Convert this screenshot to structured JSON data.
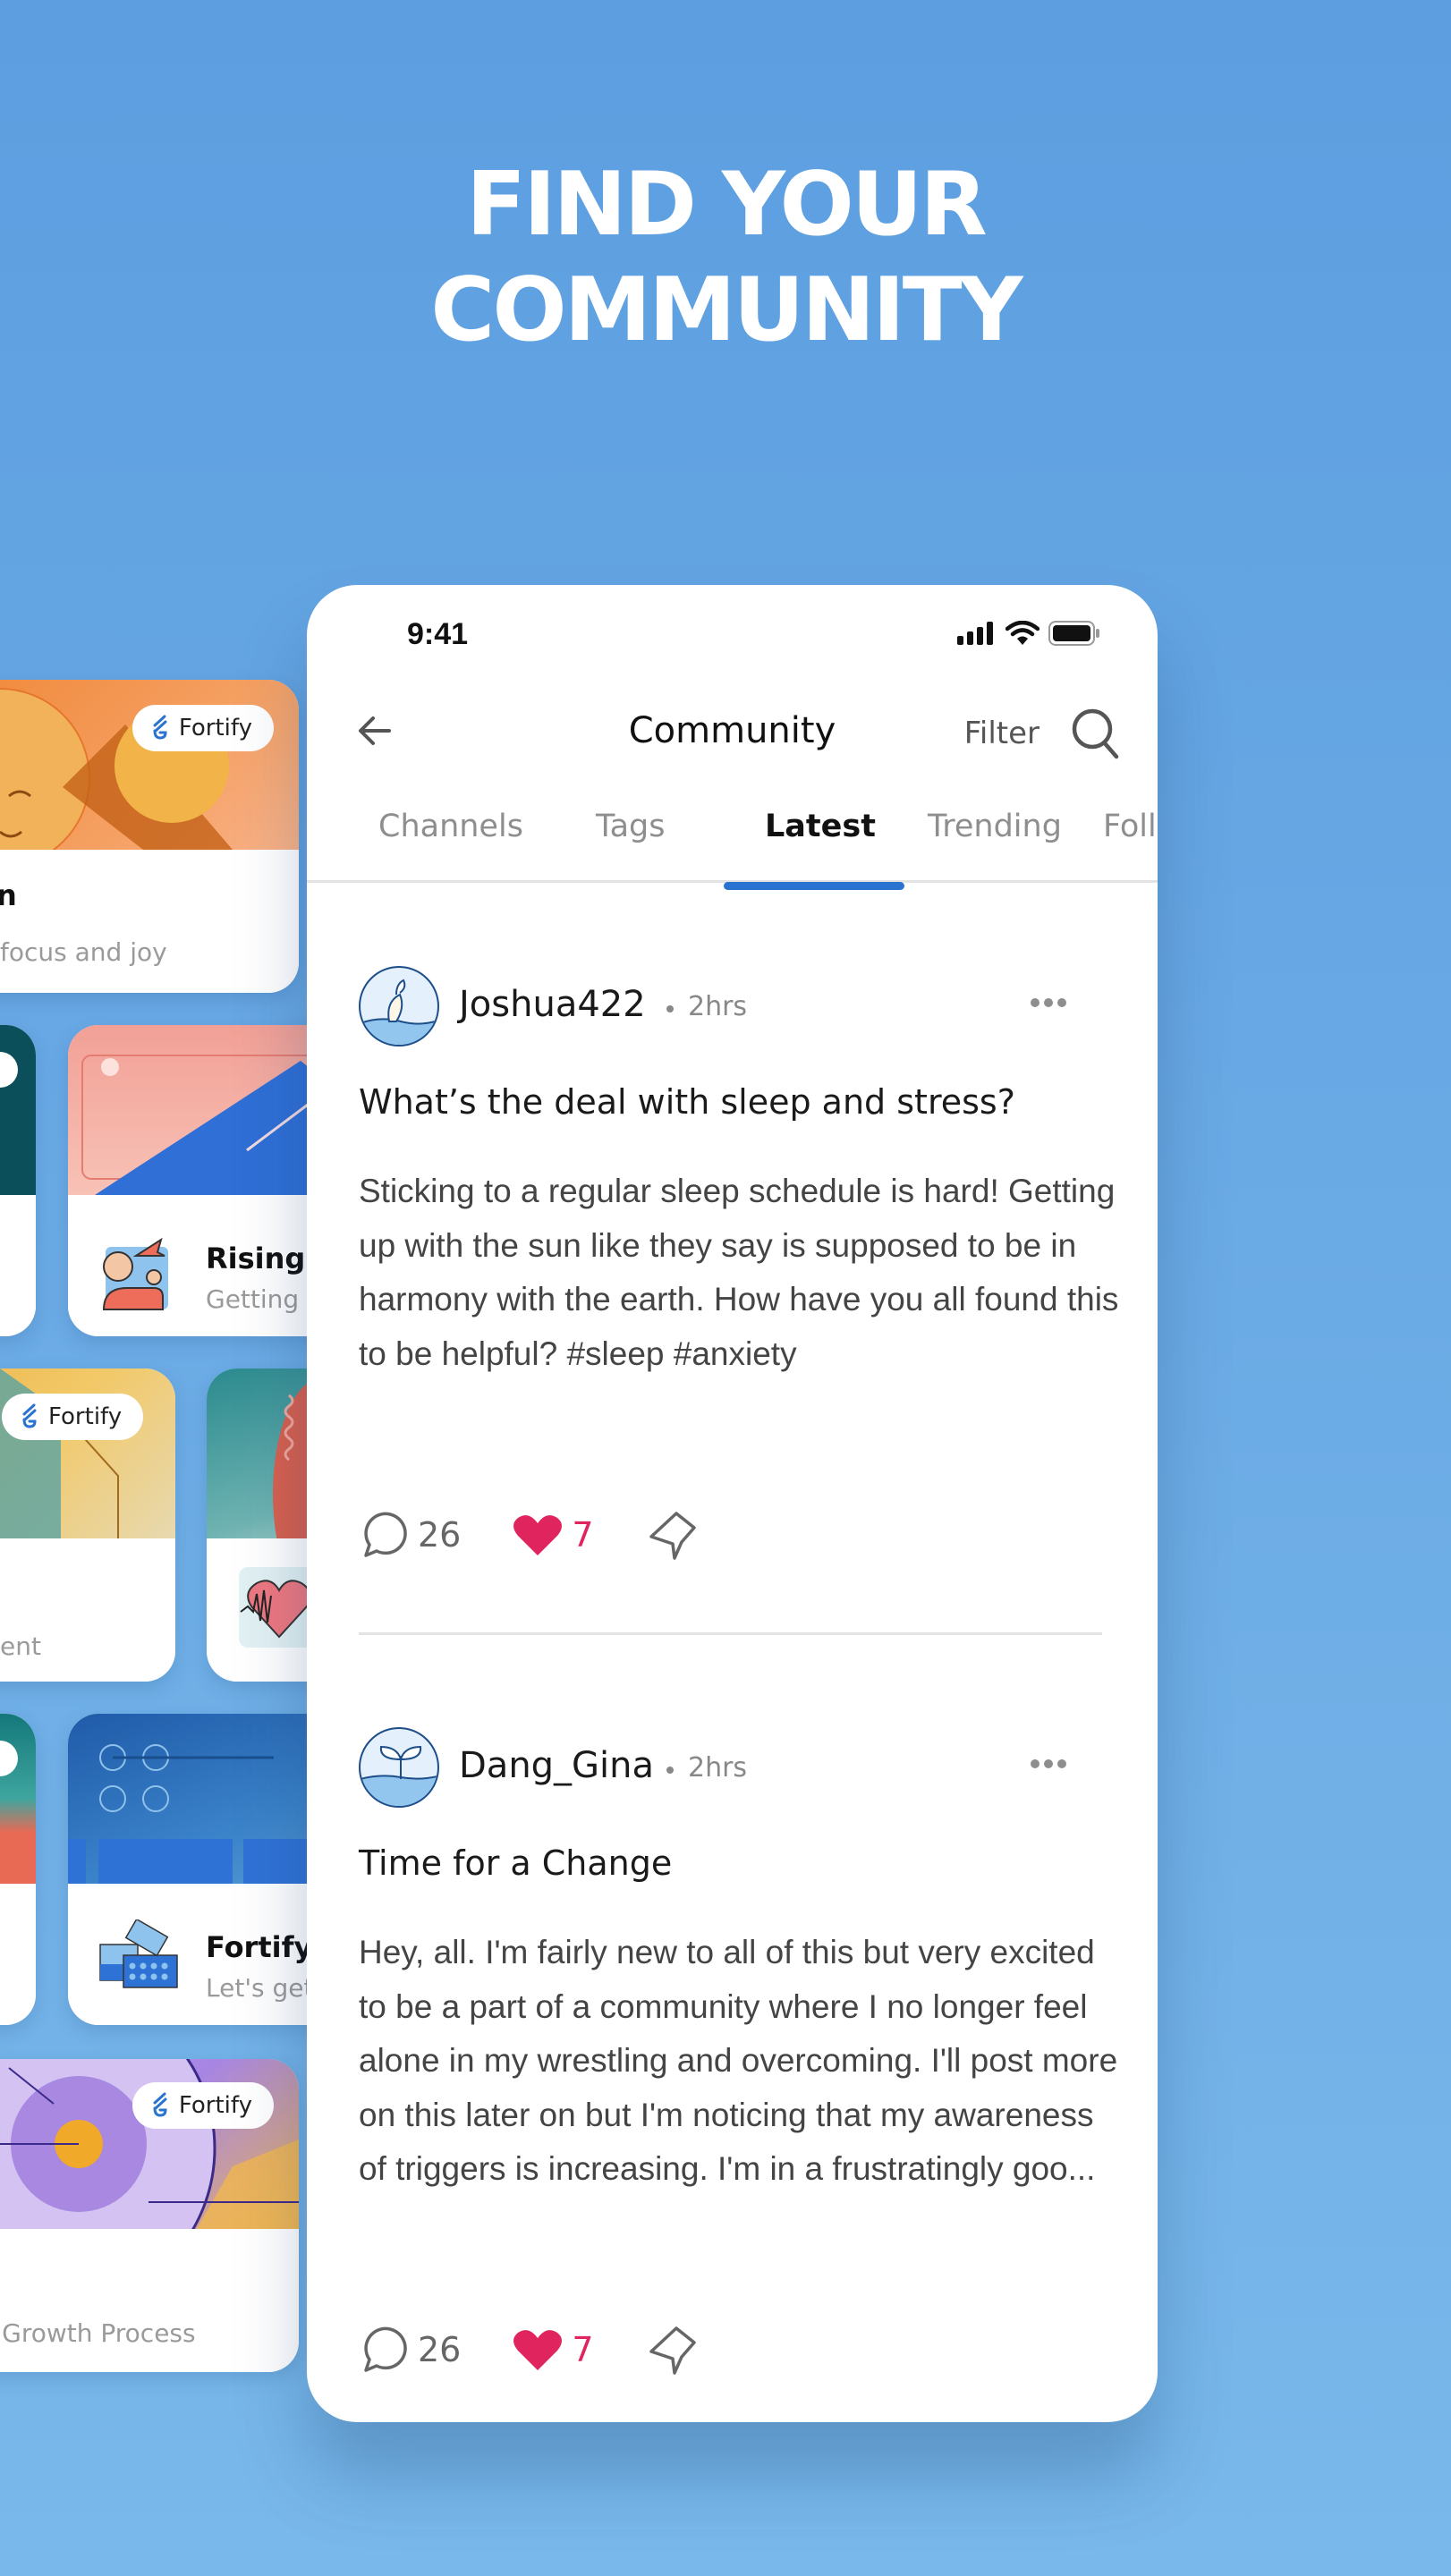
{
  "headline": [
    "FIND YOUR",
    "COMMUNITY"
  ],
  "colors": {
    "background_top": "#5c9ee0",
    "background_bottom": "#79b8ea",
    "accent": "#2a74d0",
    "like": "#e0245e",
    "brand_logo": "#2a74d0"
  },
  "side_cards": [
    {
      "badge": "Fortify",
      "title": "n",
      "subtitle": "focus and joy",
      "theme": "orange"
    },
    {
      "badge": null,
      "title": "",
      "subtitle": "",
      "theme": "dark-teal"
    },
    {
      "badge": null,
      "title": "Rising U",
      "subtitle": "Getting",
      "theme": "pink-blue",
      "icon": "flexing-person-icon"
    },
    {
      "badge": "Fortify",
      "title": "",
      "subtitle": "ent",
      "theme": "yellow-teal"
    },
    {
      "badge": null,
      "title": "",
      "subtitle": "",
      "theme": "teal-red",
      "icon": "heartbeat-heart-icon"
    },
    {
      "badge": null,
      "title": "",
      "subtitle": "",
      "theme": "teal-coral"
    },
    {
      "badge": null,
      "title": "Fortify",
      "subtitle": "Let's get",
      "theme": "blue",
      "icon": "building-blocks-icon"
    },
    {
      "badge": "Fortify",
      "title": "",
      "subtitle": "e Growth Process",
      "theme": "purple"
    }
  ],
  "status_bar": {
    "time": "9:41",
    "icons": [
      "signal-icon",
      "wifi-icon",
      "battery-icon"
    ]
  },
  "nav": {
    "title": "Community",
    "filter_label": "Filter",
    "back_icon": "arrow-left-icon",
    "search_icon": "search-icon"
  },
  "tabs": [
    {
      "label": "Channels",
      "active": false
    },
    {
      "label": "Tags",
      "active": false
    },
    {
      "label": "Latest",
      "active": true
    },
    {
      "label": "Trending",
      "active": false
    },
    {
      "label": "Foll",
      "active": false
    }
  ],
  "posts": [
    {
      "author": "Joshua422",
      "time": "2hrs",
      "title": "What’s the deal with sleep and stress?",
      "body": "Sticking to a regular sleep schedule is hard! Getting up with the sun like they say is supposed to be in harmony with the earth. How have you all found this to be helpful? #sleep #anxiety",
      "comments": "26",
      "likes": "7",
      "liked": true,
      "avatar_icon": "sprout-avatar-icon"
    },
    {
      "author": "Dang_Gina",
      "time": "2hrs",
      "title": "Time for a Change",
      "body": "Hey, all. I'm fairly new to all of this but very excited to be a part of a community where I no longer feel alone in my wrestling and overcoming. I'll post more on this later on but I'm noticing that my awareness of triggers is increasing. I'm in a frustratingly goo...",
      "comments": "26",
      "likes": "7",
      "liked": true,
      "avatar_icon": "seedling-avatar-icon"
    }
  ]
}
